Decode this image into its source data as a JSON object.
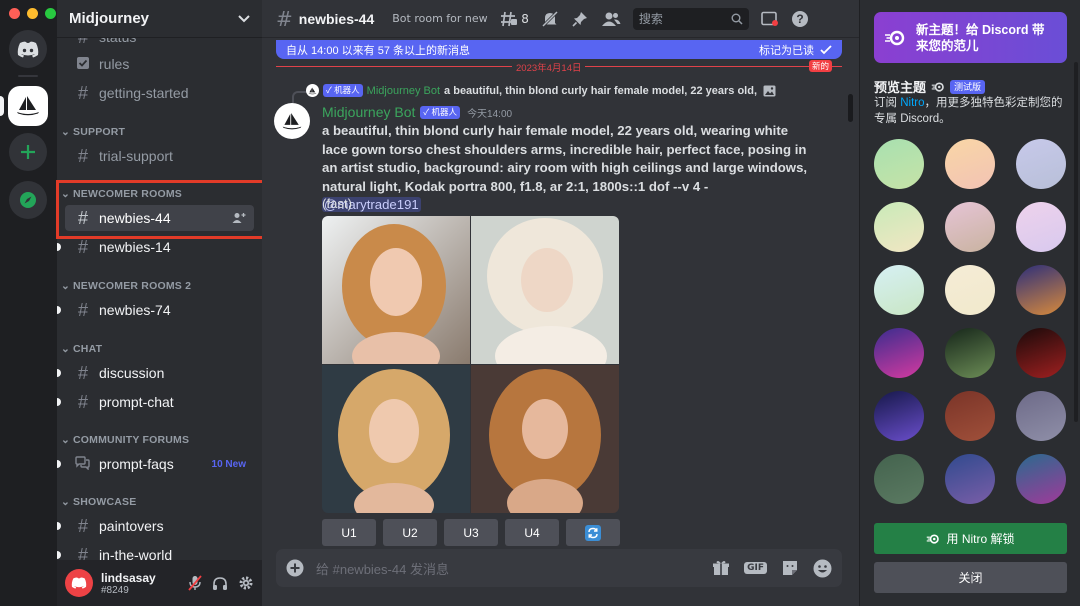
{
  "window": {
    "traffic_colors": [
      "#ff5f57",
      "#febc2e",
      "#28c840"
    ]
  },
  "rail": {
    "servers": [
      {
        "name": "discord-home",
        "color": "#5865f2"
      },
      {
        "name": "midjourney-server",
        "color": "#ffffff"
      },
      {
        "name": "add-server",
        "color": "#23a559"
      },
      {
        "name": "explore-servers",
        "color": "#23a559"
      }
    ]
  },
  "sidebar": {
    "server_name": "Midjourney",
    "partial_top": "status",
    "rules": "rules",
    "getting_started": "getting-started",
    "cat_support": "SUPPORT",
    "trial_support": "trial-support",
    "cat_newcomer": "NEWCOMER ROOMS",
    "newbies_44": "newbies-44",
    "newbies_14": "newbies-14",
    "cat_newcomer2": "NEWCOMER ROOMS 2",
    "newbies_74": "newbies-74",
    "cat_chat": "CHAT",
    "discussion": "discussion",
    "prompt_chat": "prompt-chat",
    "cat_forums": "COMMUNITY FORUMS",
    "prompt_faqs": "prompt-faqs",
    "prompt_faqs_badge": "10 New",
    "cat_showcase": "SHOWCASE",
    "paintovers": "paintovers",
    "in_the_world": "in-the-world"
  },
  "user": {
    "name": "lindsasay",
    "tag": "#8249"
  },
  "topbar": {
    "channel": "newbies-44",
    "topic": "Bot room for new ...",
    "threads_count": "8",
    "search_placeholder": "搜索"
  },
  "new_messages": {
    "text": "自从 14:00 以来有 57 条以上的新消息",
    "mark_read": "标记为已读"
  },
  "date_divider": {
    "date": "2023年4月14日",
    "new_label": "新的"
  },
  "reply": {
    "author": "Midjourney Bot",
    "badge": "✓ 机器人",
    "preview": "a beautiful, thin blond curly hair female model, 22 years old,"
  },
  "message": {
    "author": "Midjourney Bot",
    "badge": "✓ 机器人",
    "time": "今天14:00",
    "prompt": "a beautiful, thin blond curly hair female model, 22 years old, wearing white lace gown torso chest shoulders arms, incredible hair, perfect face, posing in an artist studio, background: airy room with high ceilings and large windows, natural light, Kodak portra 800, f1.8, ar 2:1, 1800s::1 dof --v 4 -",
    "mention": "@marytrade191",
    "mode": "(fast)",
    "buttons": [
      "U1",
      "U2",
      "U3",
      "U4"
    ]
  },
  "composer": {
    "placeholder": "给 #newbies-44 发消息",
    "gif_label": "GIF"
  },
  "right_panel": {
    "promo_line1": "新主题！给 Discord 带",
    "promo_line2": "来您的范儿",
    "preview_title": "预览主题",
    "beta": "测试版",
    "desc_before": "订阅 ",
    "desc_nitro": "Nitro",
    "desc_after": "，用更多独特色彩定制您的专属 Discord。",
    "unlock": "用 Nitro 解锁",
    "close": "关闭",
    "swatch_colors": [
      [
        "#a8e0b0",
        "#c6e3a7"
      ],
      [
        "#f9d6a6",
        "#f2c3b4"
      ],
      [
        "#c7c9ea",
        "#b8bfd8"
      ],
      [
        "#c8eab8",
        "#f2e6c3"
      ],
      [
        "#e6c4d6",
        "#c9b3a0"
      ],
      [
        "#eed2ec",
        "#d8c9ee"
      ],
      [
        "#d6f0f4",
        "#c9e6c4"
      ],
      [
        "#f5ecd6",
        "#f1e9cc"
      ],
      [
        "#2d2f7a",
        "#d88a3c"
      ],
      [
        "#3b2d8e",
        "#d43aa0"
      ],
      [
        "#16261a",
        "#6c8d56"
      ],
      [
        "#1a0a0a",
        "#a02020"
      ],
      [
        "#16184a",
        "#6a4ecb"
      ],
      [
        "#7a3428",
        "#a0503a"
      ],
      [
        "#6d6a88",
        "#8f8fa8"
      ],
      [
        "#44634e",
        "#5b7a62"
      ],
      [
        "#304a8e",
        "#7a5ea8"
      ],
      [
        "#2a6a8e",
        "#a03a9a"
      ]
    ]
  }
}
